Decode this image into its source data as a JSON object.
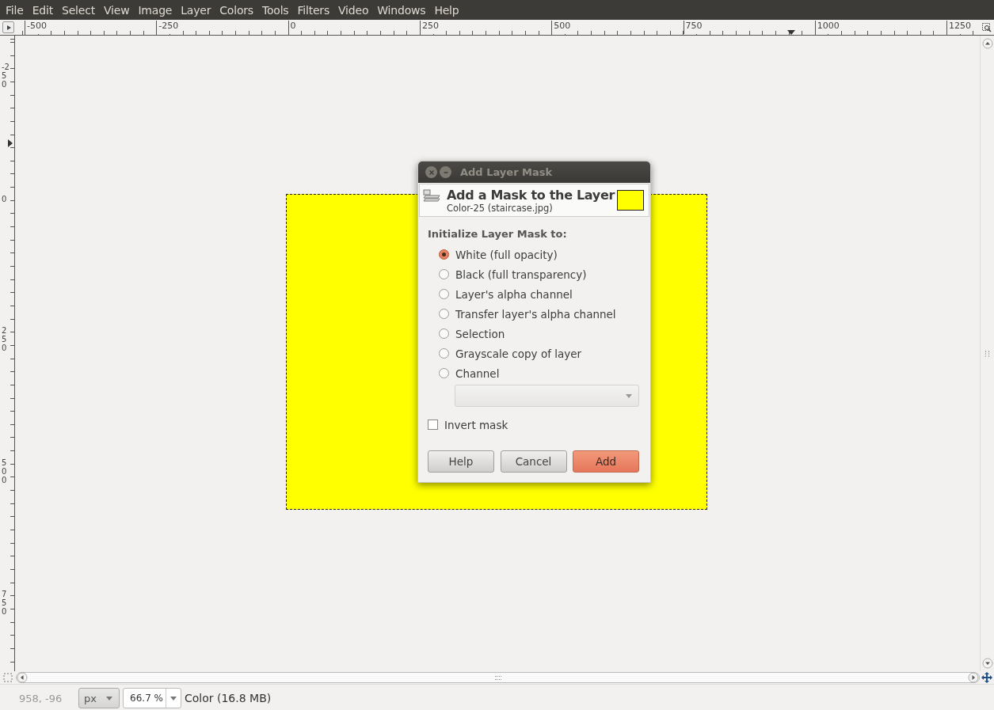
{
  "menu": [
    "File",
    "Edit",
    "Select",
    "View",
    "Image",
    "Layer",
    "Colors",
    "Tools",
    "Filters",
    "Video",
    "Windows",
    "Help"
  ],
  "rulers": {
    "horizontal": [
      "-500",
      "-250",
      "0",
      "250",
      "500",
      "750",
      "1000",
      "1250"
    ],
    "vertical": [
      "-250",
      "0",
      "250",
      "500",
      "750"
    ]
  },
  "dialog": {
    "title": "Add Layer Mask",
    "heading": "Add a Mask to the Layer",
    "subheading": "Color-25 (staircase.jpg)",
    "section": "Initialize Layer Mask to:",
    "options": [
      {
        "label": "White (full opacity)",
        "selected": true
      },
      {
        "label": "Black (full transparency)",
        "selected": false
      },
      {
        "label": "Layer's alpha channel",
        "selected": false
      },
      {
        "label": "Transfer layer's alpha channel",
        "selected": false
      },
      {
        "label": "Selection",
        "selected": false
      },
      {
        "label": "Grayscale copy of layer",
        "selected": false
      },
      {
        "label": "Channel",
        "selected": false
      }
    ],
    "channel_dropdown": {
      "disabled": true
    },
    "invert": {
      "label": "Invert mask",
      "checked": false
    },
    "buttons": [
      {
        "label": "Help",
        "kind": "normal"
      },
      {
        "label": "Cancel",
        "kind": "normal"
      },
      {
        "label": "Add",
        "kind": "suggested"
      }
    ]
  },
  "status_bar": {
    "coordinates": "958, -96",
    "unit": "px",
    "zoom": "66.7 %",
    "info": "Color (16.8 MB)"
  }
}
